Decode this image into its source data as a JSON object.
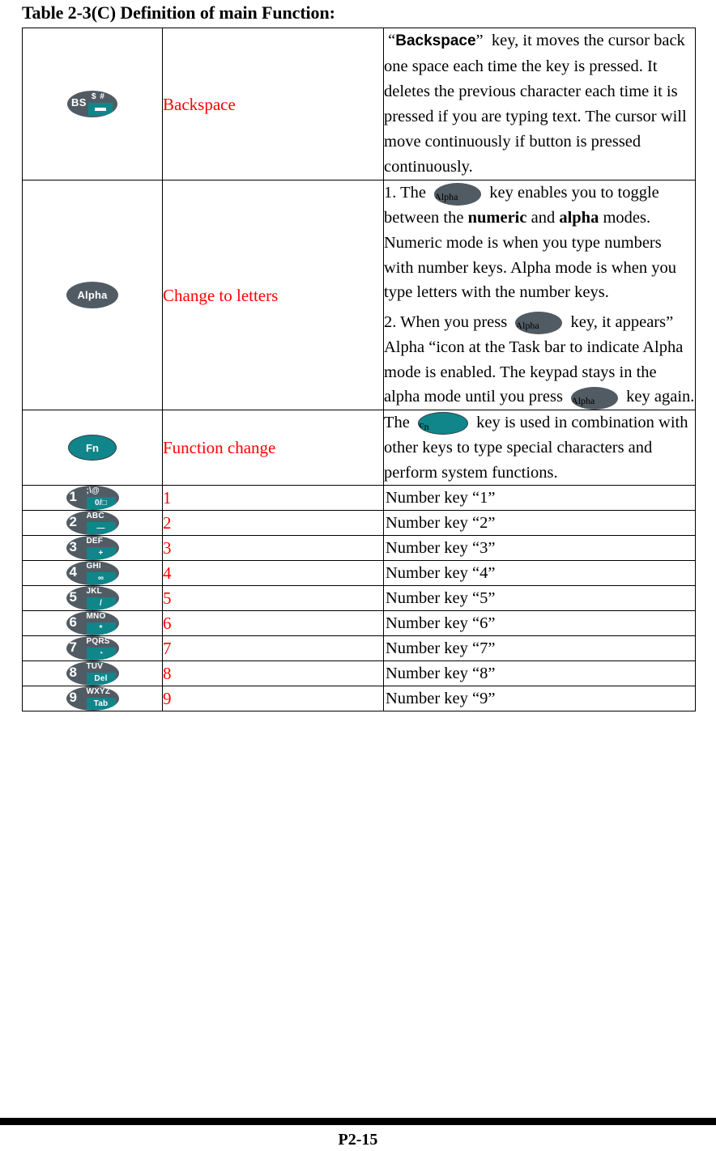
{
  "page": {
    "title": "Table 2-3(C) Definition of main Function:",
    "footer": "P2-15"
  },
  "colors": {
    "label_red": "#ff0000",
    "key_gray": "#515b63",
    "key_teal": "#10868a",
    "key_border": "#2d3b44",
    "text_black": "#000000"
  },
  "rows": [
    {
      "icon": "backspace-key-icon",
      "icon_text": {
        "main": "BS",
        "symbols": "$ #",
        "fn_glyph": "▬"
      },
      "label": "Backspace",
      "description": {
        "quoted_term": "Backspace",
        "text": "key, it moves the cursor back one space each time the key is pressed. It deletes the previous character each time it is pressed if you are typing text. The cursor will move continuously if button is pressed continuously."
      }
    },
    {
      "icon": "alpha-key-icon",
      "icon_text": {
        "main": "Alpha"
      },
      "label": "Change to letters",
      "description": {
        "p1_before": "1. The",
        "p1_after_key": "key enables you to toggle between the",
        "bold1": "numeric",
        "p1_mid": "and",
        "bold2": "alpha",
        "p1_tail": "modes. Numeric mode is when you type numbers with number keys. Alpha mode is when you type letters with the number keys.",
        "p2_before": "2. When you press",
        "p2_after_key": "key, it appears” Alpha “icon at the Task bar to indicate Alpha mode is enabled. The keypad stays in the alpha mode",
        "p3_before": "until you press",
        "p3_after_key": "key again.",
        "inline_key_label": "Alpha"
      }
    },
    {
      "icon": "fn-key-icon",
      "icon_text": {
        "main": "Fn"
      },
      "label": "Function change",
      "description": {
        "before": "The",
        "after_key": "key is used in combination with other keys to type special characters and perform system functions.",
        "inline_key_label": "Fn"
      }
    },
    {
      "icon": "numeric-key-1-icon",
      "icon_text": {
        "digit": "1",
        "letters": ";\\@",
        "fn_label": "0/□"
      },
      "label": "1",
      "desc_line": "Number key “1”"
    },
    {
      "icon": "numeric-key-2-icon",
      "icon_text": {
        "digit": "2",
        "letters": "ABC",
        "fn_label": "—"
      },
      "label": "2",
      "desc_line": "Number key “2”"
    },
    {
      "icon": "numeric-key-3-icon",
      "icon_text": {
        "digit": "3",
        "letters": "DEF",
        "fn_label": "+"
      },
      "label": "3",
      "desc_line": "Number key “3”"
    },
    {
      "icon": "numeric-key-4-icon",
      "icon_text": {
        "digit": "4",
        "letters": "GHI",
        "fn_label": "∞"
      },
      "label": "4",
      "desc_line": "Number key “4”"
    },
    {
      "icon": "numeric-key-5-icon",
      "icon_text": {
        "digit": "5",
        "letters": "JKL",
        "fn_label": "/"
      },
      "label": "5",
      "desc_line": "Number key “5”"
    },
    {
      "icon": "numeric-key-6-icon",
      "icon_text": {
        "digit": "6",
        "letters": "MNO",
        "fn_label": "*"
      },
      "label": "6",
      "desc_line": "Number key “6”"
    },
    {
      "icon": "numeric-key-7-icon",
      "icon_text": {
        "digit": "7",
        "letters": "PQRS",
        "fn_label": "◔"
      },
      "label": "7",
      "desc_line": "Number key “7”"
    },
    {
      "icon": "numeric-key-8-icon",
      "icon_text": {
        "digit": "8",
        "letters": "TUV",
        "fn_label": "Del"
      },
      "label": "8",
      "desc_line": "Number key “8”"
    },
    {
      "icon": "numeric-key-9-icon",
      "icon_text": {
        "digit": "9",
        "letters": "WXYZ",
        "fn_label": "Tab"
      },
      "label": "9",
      "desc_line": "Number key “9”"
    }
  ]
}
